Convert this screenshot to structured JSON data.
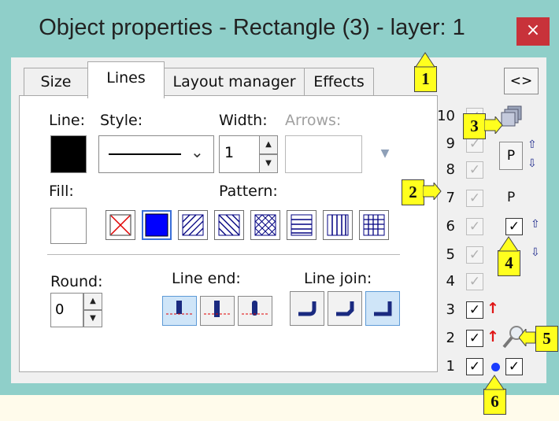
{
  "window": {
    "title": "Object properties - Rectangle (3) - layer: 1",
    "close_icon": "×"
  },
  "tabs": [
    {
      "label": "Size",
      "active": false
    },
    {
      "label": "Lines",
      "active": true
    },
    {
      "label": "Layout manager",
      "active": false
    },
    {
      "label": "Effects",
      "active": false
    }
  ],
  "lines_tab": {
    "line_label": "Line:",
    "style_label": "Style:",
    "width_label": "Width:",
    "arrows_label": "Arrows:",
    "width_value": "1",
    "line_color": "#000000",
    "fill_label": "Fill:",
    "fill_color": "#ffffff",
    "pattern_label": "Pattern:",
    "patterns": [
      "none-cross",
      "solid",
      "diagonal-forward",
      "diagonal-back",
      "diagonal-cross",
      "horizontal",
      "vertical",
      "grid"
    ],
    "selected_pattern": "solid",
    "round_label": "Round:",
    "round_value": "0",
    "line_end_label": "Line end:",
    "line_join_label": "Line join:",
    "selected_line_end": 0,
    "selected_line_join": 2
  },
  "layers": {
    "toggle_button": "<>",
    "p_label": "P",
    "rows": [
      {
        "num": "10",
        "checked": true,
        "enabled": false
      },
      {
        "num": "9",
        "checked": true,
        "enabled": false
      },
      {
        "num": "8",
        "checked": true,
        "enabled": false
      },
      {
        "num": "7",
        "checked": true,
        "enabled": false
      },
      {
        "num": "6",
        "checked": true,
        "enabled": false
      },
      {
        "num": "5",
        "checked": true,
        "enabled": false
      },
      {
        "num": "4",
        "checked": true,
        "enabled": false
      },
      {
        "num": "3",
        "checked": true,
        "enabled": true
      },
      {
        "num": "2",
        "checked": true,
        "enabled": true
      },
      {
        "num": "1",
        "checked": true,
        "enabled": true
      }
    ]
  },
  "callouts": [
    "1",
    "2",
    "3",
    "4",
    "5",
    "6"
  ],
  "colors": {
    "window_frame": "#8fcfc9",
    "close_red": "#c8323a",
    "callout_yellow": "#ffff1e",
    "selected_blue": "#0000ff",
    "arrow_red": "#e01515"
  }
}
